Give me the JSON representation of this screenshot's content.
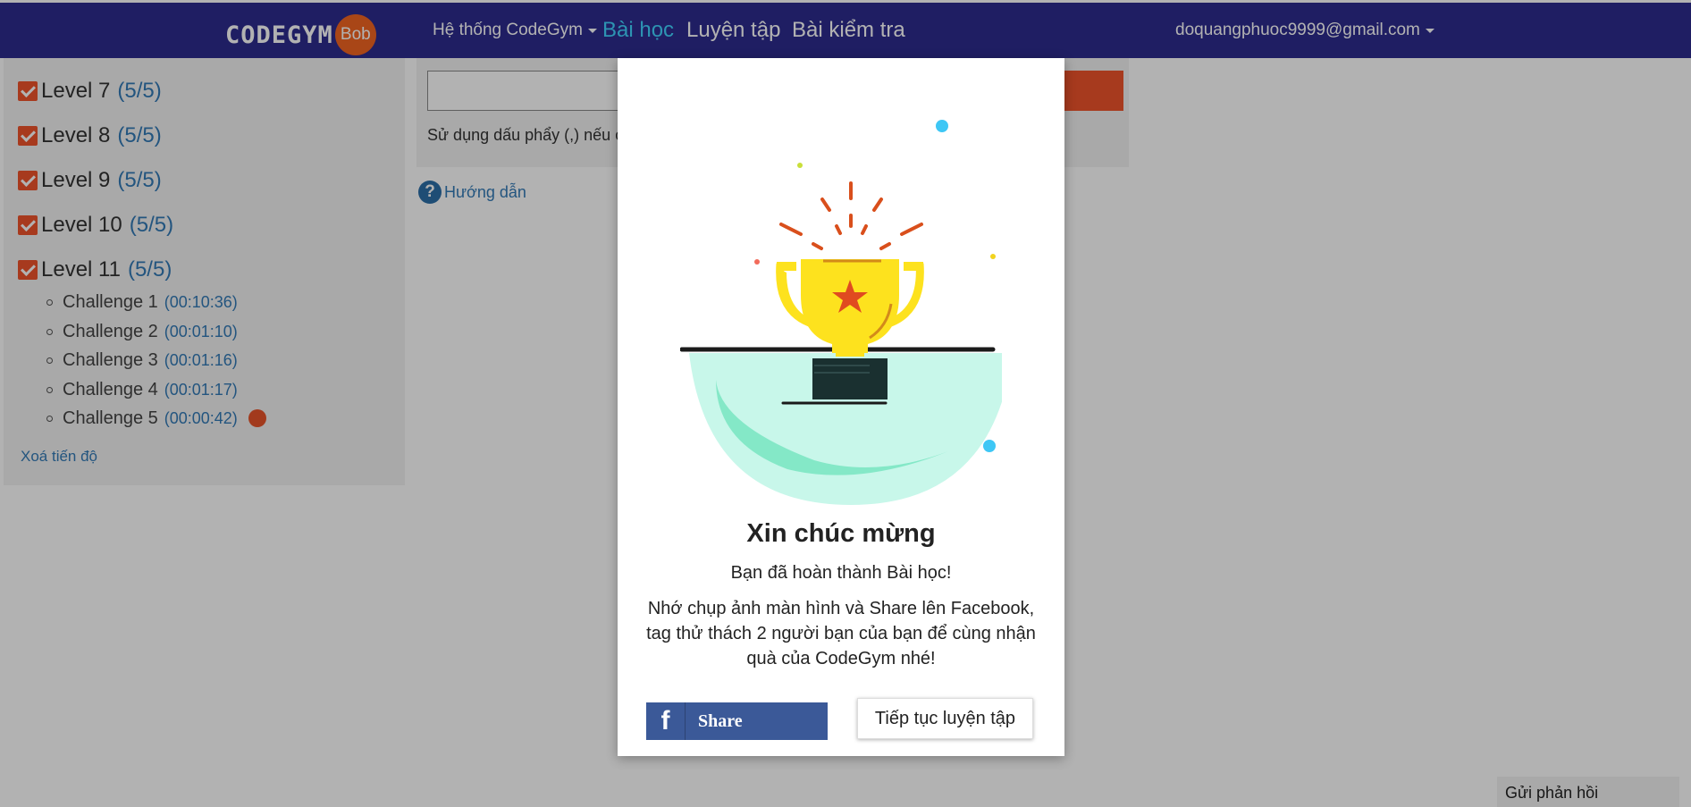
{
  "navbar": {
    "logo_text": "CODEGYM",
    "logo_badge": "Bob",
    "system_menu": "Hệ thống CodeGym",
    "lesson_link": "Bài học",
    "practice_link": "Luyện tập",
    "test_link": "Bài kiểm tra",
    "user_email": "doquangphuoc9999@gmail.com",
    "colors": {
      "background": "#2d2b8f",
      "active_link": "#41d4ff"
    }
  },
  "sidebar": {
    "levels": [
      {
        "label": "Level 7",
        "progress": "(5/5)",
        "checked": true
      },
      {
        "label": "Level 8",
        "progress": "(5/5)",
        "checked": true
      },
      {
        "label": "Level 9",
        "progress": "(5/5)",
        "checked": true
      },
      {
        "label": "Level 10",
        "progress": "(5/5)",
        "checked": true
      },
      {
        "label": "Level 11",
        "progress": "(5/5)",
        "checked": true
      }
    ],
    "challenges": [
      {
        "label": "Challenge 1",
        "time": "(00:10:36)"
      },
      {
        "label": "Challenge 2",
        "time": "(00:01:10)"
      },
      {
        "label": "Challenge 3",
        "time": "(00:01:16)"
      },
      {
        "label": "Challenge 4",
        "time": "(00:01:17)"
      },
      {
        "label": "Challenge 5",
        "time": "(00:00:42)",
        "current": true
      }
    ],
    "clear_progress": "Xoá tiến độ"
  },
  "main": {
    "answer_value": "",
    "hint_text": "Sử dụng dấu phẩy (,) nếu c",
    "guide_label": "Hướng dẫn",
    "guide_icon": "question-circle-icon"
  },
  "feedback_label": "Gửi phản hồi",
  "modal": {
    "illustration": "trophy-illustration",
    "title": "Xin chúc mừng",
    "subtitle": "Bạn đã hoàn thành Bài học!",
    "message": "Nhớ chụp ảnh màn hình và Share lên Facebook, tag thử thách 2 người bạn của bạn để cùng nhận quà của CodeGym nhé!",
    "share_icon": "f",
    "share_label": "Share",
    "continue_label": "Tiếp tục luyện tập",
    "colors": {
      "facebook": "#3b5998",
      "accent": "#f0542b",
      "trophy": "#fde21e"
    }
  }
}
